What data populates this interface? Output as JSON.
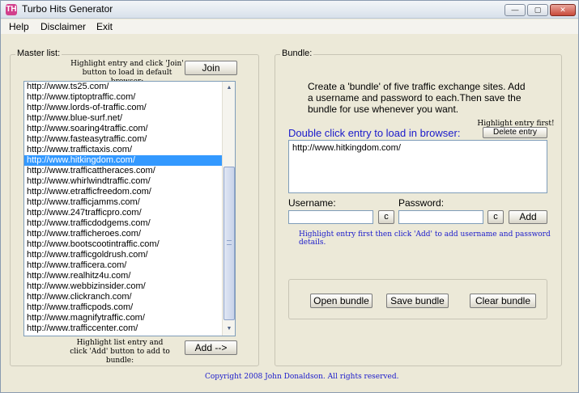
{
  "window": {
    "title": "Turbo Hits Generator",
    "app_icon": "TH"
  },
  "window_buttons": {
    "minimize": "—",
    "restore": "▢",
    "close": "✕"
  },
  "menu": [
    "Help",
    "Disclaimer",
    "Exit"
  ],
  "master": {
    "legend": "Master list:",
    "hint_top": "Highlight entry and click 'Join' button to load in default browser:",
    "join_label": "Join",
    "urls": [
      "http://www.ts25.com/",
      "http://www.tiptoptraffic.com/",
      "http://www.lords-of-traffic.com/",
      "http://www.blue-surf.net/",
      "http://www.soaring4traffic.com/",
      "http://www.fasteasytraffic.com/",
      "http://www.traffictaxis.com/",
      "http://www.hitkingdom.com/",
      "http://www.trafficattheraces.com/",
      "http://www.whirlwindtraffic.com/",
      "http://www.etrafficfreedom.com/",
      "http://www.trafficjamms.com/",
      "http://www.247trafficpro.com/",
      "http://www.trafficdodgems.com/",
      "http://www.trafficheroes.com/",
      "http://www.bootscootintraffic.com/",
      "http://www.trafficgoldrush.com/",
      "http://www.trafficera.com/",
      "http://www.realhitz4u.com/",
      "http://www.webbizinsider.com/",
      "http://www.clickranch.com/",
      "http://www.trafficpods.com/",
      "http://www.magnifytraffic.com/",
      "http://www.trafficcenter.com/"
    ],
    "selected_index": 7,
    "hint_bottom": "Highlight list entry and click 'Add' button to add to bundle:",
    "add_label": "Add -->"
  },
  "bundle": {
    "legend": "Bundle:",
    "description": "Create a 'bundle' of five traffic exchange sites. Add a username and password to each.Then save the bundle for use whenever you want.",
    "highlight_first": "Highlight entry first!",
    "delete_label": "Delete entry",
    "double_click_label": "Double click entry to load in browser:",
    "entries": [
      "http://www.hitkingdom.com/"
    ],
    "username_label": "Username:",
    "password_label": "Password:",
    "username_value": "",
    "password_value": "",
    "clear_short": "c",
    "add_label": "Add",
    "hint": "Highlight entry first then click 'Add' to add username and password details.",
    "open_label": "Open bundle",
    "save_label": "Save bundle",
    "clear_label": "Clear bundle"
  },
  "footer": {
    "copyright": "Copyright 2008 John Donaldson. All rights reserved."
  }
}
